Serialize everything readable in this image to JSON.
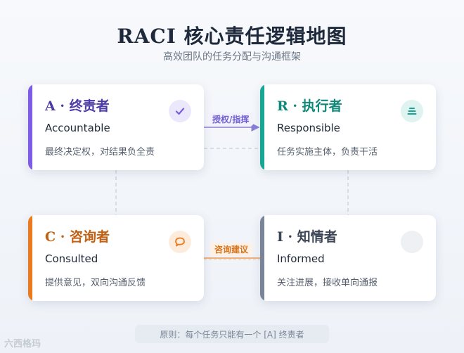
{
  "title": "RACI 核心责任逻辑地图",
  "subtitle": "高效团队的任务分配与沟通框架",
  "colors": {
    "accountable": "#7c5ce6",
    "responsible": "#16a693",
    "consulted": "#ea7a1f",
    "informed": "#7a8499",
    "connector_dash": "#cfd5de"
  },
  "cards": {
    "accountable": {
      "heading": "A · 终责者",
      "en": "Accountable",
      "desc": "最终决定权，对结果负全责",
      "icon": "checkmark-icon"
    },
    "responsible": {
      "heading": "R · 执行者",
      "en": "Responsible",
      "desc": "任务实施主体，负责干活",
      "icon": "list-lines-icon"
    },
    "consulted": {
      "heading": "C · 咨询者",
      "en": "Consulted",
      "desc": "提供意见，双向沟通反馈",
      "icon": "speech-bubble-icon"
    },
    "informed": {
      "heading": "I · 知情者",
      "en": "Informed",
      "desc": "关注进展，接收单向通报",
      "icon": "blank-circle-icon"
    }
  },
  "connectors": {
    "authorize": "授权/指挥",
    "consult": "咨询建议"
  },
  "principle": "原则：每个任务只能有一个 [A] 终责者",
  "watermark": "六西格玛"
}
